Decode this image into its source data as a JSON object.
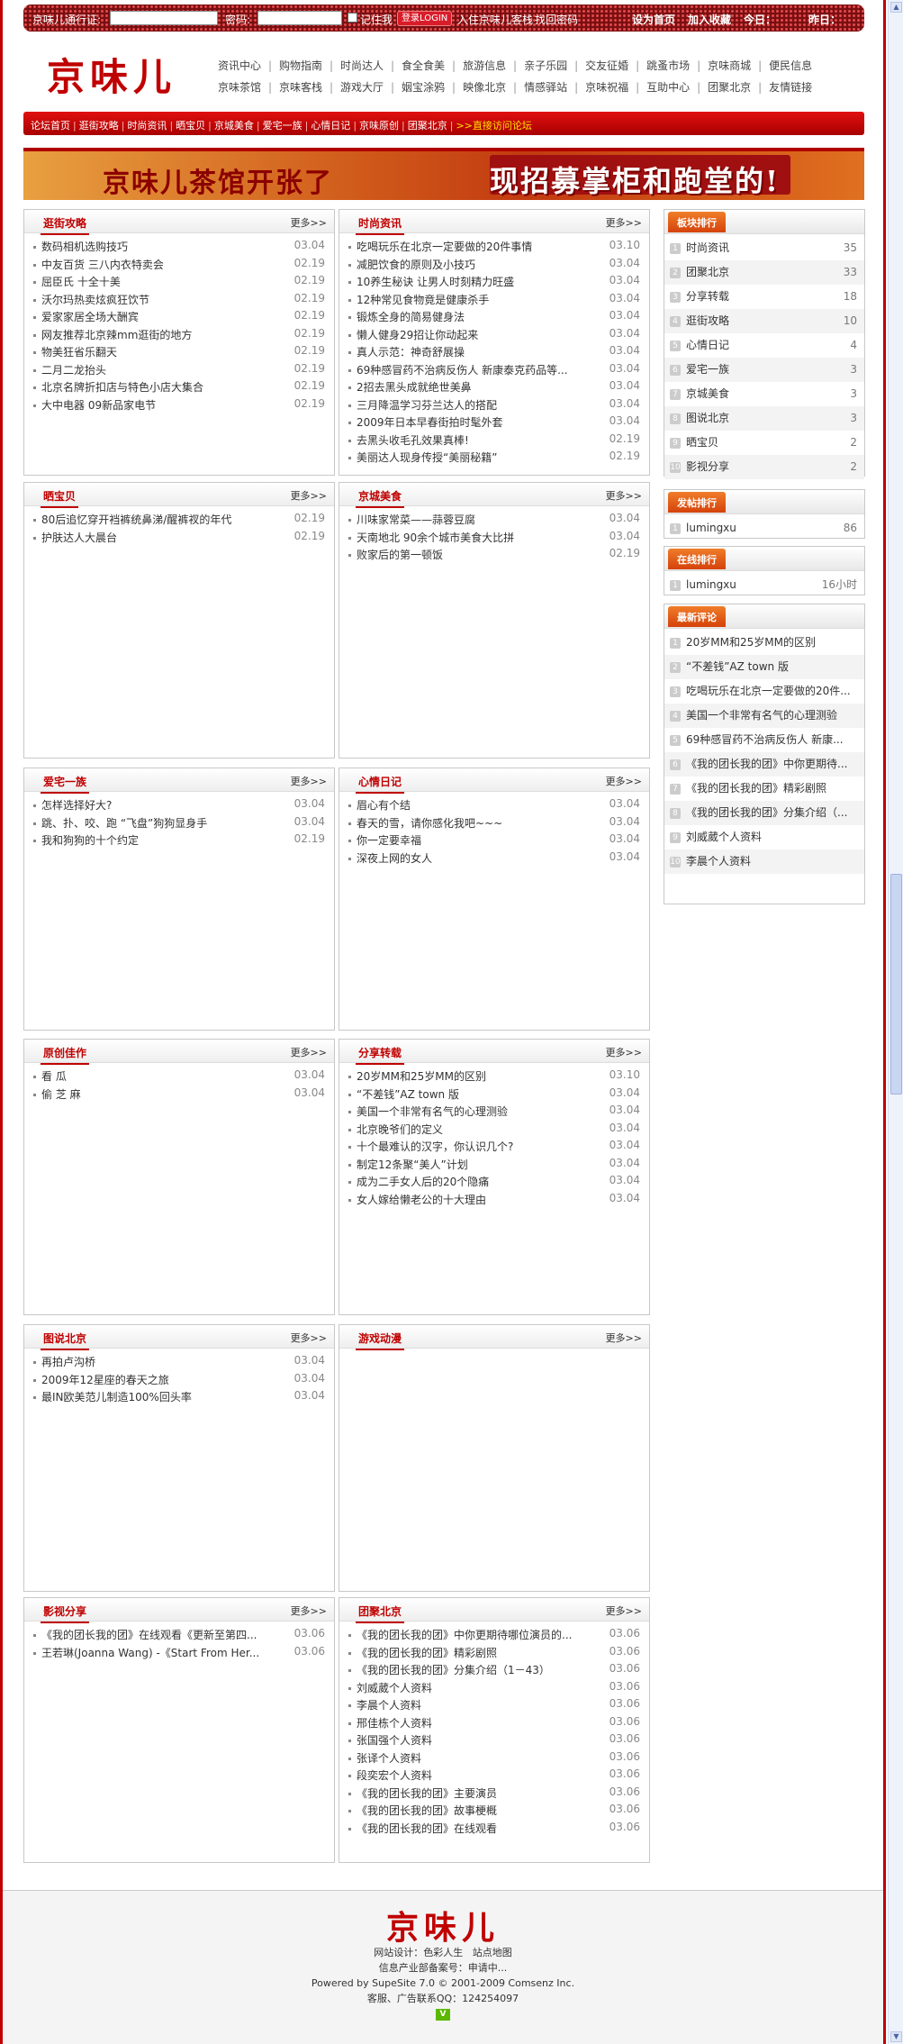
{
  "topbar": {
    "user_label": "京味儿通行证:",
    "pass_label": "密码:",
    "remember_label": "记住我",
    "login_button": "登录LOGIN",
    "register_link": "入住京味儿客栈",
    "forgot_link": "找回密码",
    "set_home": "设为首页",
    "add_fav": "加入收藏",
    "today": "今日：",
    "yesterday": "昨日："
  },
  "logo": "京味儿",
  "nav": {
    "row1": [
      "资讯中心",
      "购物指南",
      "时尚达人",
      "食全食美",
      "旅游信息",
      "亲子乐园",
      "交友征婚",
      "跳蚤市场",
      "京味商城",
      "便民信息"
    ],
    "row2": [
      "京味茶馆",
      "京味客栈",
      "游戏大厅",
      "姻宝涂鸦",
      "映像北京",
      "情感驿站",
      "京味祝福",
      "互助中心",
      "团聚北京",
      "友情链接"
    ]
  },
  "redbar": {
    "links": [
      "论坛首页",
      "逛街攻略",
      "时尚资讯",
      "晒宝贝",
      "京城美食",
      "爱宅一族",
      "心情日记",
      "京味原创",
      "团聚北京"
    ],
    "forum": ">>直接访问论坛"
  },
  "banner": {
    "left": "京味儿茶馆开张了",
    "right": "现招募掌柜和跑堂的!"
  },
  "more": "更多>>",
  "panels": [
    {
      "title": "逛街攻略",
      "items": [
        {
          "t": "数码相机选购技巧",
          "d": "03.04"
        },
        {
          "t": "中友百货 三八内衣特卖会",
          "d": "02.19"
        },
        {
          "t": "屈臣氏 十全十美",
          "d": "02.19"
        },
        {
          "t": "沃尔玛热卖炫疯狂饮节",
          "d": "02.19"
        },
        {
          "t": "爱家家居全场大酬宾",
          "d": "02.19"
        },
        {
          "t": "网友推荐北京辣mm逛街的地方",
          "d": "02.19"
        },
        {
          "t": "物美狂省乐翻天",
          "d": "02.19"
        },
        {
          "t": "二月二龙抬头",
          "d": "02.19"
        },
        {
          "t": "北京名牌折扣店与特色小店大集合",
          "d": "02.19"
        },
        {
          "t": "大中电器 09新品家电节",
          "d": "02.19"
        }
      ]
    },
    {
      "title": "时尚资讯",
      "items": [
        {
          "t": "吃喝玩乐在北京一定要做的20件事情",
          "d": "03.10"
        },
        {
          "t": "减肥饮食的原则及小技巧",
          "d": "03.04"
        },
        {
          "t": "10养生秘诀 让男人时刻精力旺盛",
          "d": "03.04"
        },
        {
          "t": "12种常见食物竟是健康杀手",
          "d": "03.04"
        },
        {
          "t": "锻炼全身的简易健身法",
          "d": "03.04"
        },
        {
          "t": "懒人健身29招让你动起来",
          "d": "03.04"
        },
        {
          "t": "真人示范：神奇舒展操",
          "d": "03.04"
        },
        {
          "t": "69种感冒药不治病反伤人 新康泰克药品等...",
          "d": "03.04"
        },
        {
          "t": "2招去黑头成就绝世美鼻",
          "d": "03.04"
        },
        {
          "t": "三月降温学习芬兰达人的搭配",
          "d": "03.04"
        },
        {
          "t": "2009年日本早春街拍时髦外套",
          "d": "03.04"
        },
        {
          "t": "去黑头收毛孔效果真棒!",
          "d": "02.19"
        },
        {
          "t": "美丽达人现身传授“美丽秘籍”",
          "d": "02.19"
        }
      ]
    },
    {
      "title": "晒宝贝",
      "items": [
        {
          "t": "80后追忆穿开裆裤统鼻涕/醒裤衩的年代",
          "d": "02.19"
        },
        {
          "t": "护肤达人大晨台",
          "d": "02.19"
        }
      ]
    },
    {
      "title": "京城美食",
      "items": [
        {
          "t": "川味家常菜——蒜蓉豆腐",
          "d": "03.04"
        },
        {
          "t": "天南地北 90余个城市美食大比拼",
          "d": "03.04"
        },
        {
          "t": "败家后的第一顿饭",
          "d": "02.19"
        }
      ]
    },
    {
      "title": "爱宅一族",
      "items": [
        {
          "t": "怎样选择好大?",
          "d": "03.04"
        },
        {
          "t": "跳、扑、咬、跑 “飞盘”狗狗显身手",
          "d": "03.04"
        },
        {
          "t": "我和狗狗的十个约定",
          "d": "02.19"
        }
      ]
    },
    {
      "title": "心情日记",
      "items": [
        {
          "t": "眉心有个结",
          "d": "03.04"
        },
        {
          "t": "春天的雪，请你感化我吧~~~",
          "d": "03.04"
        },
        {
          "t": "你一定要幸福",
          "d": "03.04"
        },
        {
          "t": "深夜上网的女人",
          "d": "03.04"
        }
      ]
    },
    {
      "title": "原创佳作",
      "items": [
        {
          "t": "看 瓜",
          "d": "03.04"
        },
        {
          "t": "偷 芝 麻",
          "d": "03.04"
        }
      ]
    },
    {
      "title": "分享转载",
      "items": [
        {
          "t": "20岁MM和25岁MM的区别",
          "d": "03.10"
        },
        {
          "t": "“不差钱”AZ town 版",
          "d": "03.04"
        },
        {
          "t": "美国一个非常有名气的心理测验",
          "d": "03.04"
        },
        {
          "t": "北京晚爷们的定义",
          "d": "03.04"
        },
        {
          "t": "十个最难认的汉字，你认识几个?",
          "d": "03.04"
        },
        {
          "t": "制定12条聚“美人”计划",
          "d": "03.04"
        },
        {
          "t": "成为二手女人后的20个隐痛",
          "d": "03.04"
        },
        {
          "t": "女人嫁给懒老公的十大理由",
          "d": "03.04"
        }
      ]
    },
    {
      "title": "图说北京",
      "items": [
        {
          "t": "再拍卢沟桥",
          "d": "03.04"
        },
        {
          "t": "2009年12星座的春天之旅",
          "d": "03.04"
        },
        {
          "t": "最IN欧美范儿制造100%回头率",
          "d": "03.04"
        }
      ]
    },
    {
      "title": "游戏动漫",
      "items": []
    },
    {
      "title": "影视分享",
      "items": [
        {
          "t": "《我的团长我的团》在线观看《更新至第四...",
          "d": "03.06"
        },
        {
          "t": "王若琳(Joanna Wang) -《Start From Her...",
          "d": "03.06"
        }
      ]
    },
    {
      "title": "团聚北京",
      "items": [
        {
          "t": "《我的团长我的团》中你更期待哪位演员的...",
          "d": "03.06"
        },
        {
          "t": "《我的团长我的团》精彩剧照",
          "d": "03.06"
        },
        {
          "t": "《我的团长我的团》分集介绍（1－43）",
          "d": "03.06"
        },
        {
          "t": "刘威葳个人资料",
          "d": "03.06"
        },
        {
          "t": "李晨个人资料",
          "d": "03.06"
        },
        {
          "t": "邢佳栋个人资料",
          "d": "03.06"
        },
        {
          "t": "张国强个人资料",
          "d": "03.06"
        },
        {
          "t": "张译个人资料",
          "d": "03.06"
        },
        {
          "t": "段奕宏个人资料",
          "d": "03.06"
        },
        {
          "t": "《我的团长我的团》主要演员",
          "d": "03.06"
        },
        {
          "t": "《我的团长我的团》故事梗概",
          "d": "03.06"
        },
        {
          "t": "《我的团长我的团》在线观看",
          "d": "03.06"
        }
      ]
    }
  ],
  "sidebar": {
    "section_rank": {
      "title": "板块排行",
      "items": [
        {
          "n": "1",
          "t": "时尚资讯",
          "c": "35"
        },
        {
          "n": "2",
          "t": "团聚北京",
          "c": "33"
        },
        {
          "n": "3",
          "t": "分享转载",
          "c": "18"
        },
        {
          "n": "4",
          "t": "逛街攻略",
          "c": "10"
        },
        {
          "n": "5",
          "t": "心情日记",
          "c": "4"
        },
        {
          "n": "6",
          "t": "爱宅一族",
          "c": "3"
        },
        {
          "n": "7",
          "t": "京城美食",
          "c": "3"
        },
        {
          "n": "8",
          "t": "图说北京",
          "c": "3"
        },
        {
          "n": "9",
          "t": "晒宝贝",
          "c": "2"
        },
        {
          "n": "10",
          "t": "影视分享",
          "c": "2"
        }
      ]
    },
    "post_rank": {
      "title": "发帖排行",
      "items": [
        {
          "n": "1",
          "t": "lumingxu",
          "c": "86"
        }
      ]
    },
    "online_rank": {
      "title": "在线排行",
      "items": [
        {
          "n": "1",
          "t": "lumingxu",
          "c": "16小时"
        }
      ]
    },
    "hot_comments": {
      "title": "最新评论",
      "items": [
        {
          "n": "1",
          "t": "20岁MM和25岁MM的区别"
        },
        {
          "n": "2",
          "t": "“不差钱”AZ town 版"
        },
        {
          "n": "3",
          "t": "吃喝玩乐在北京一定要做的20件..."
        },
        {
          "n": "4",
          "t": "美国一个非常有名气的心理测验"
        },
        {
          "n": "5",
          "t": "69种感冒药不治病反伤人 新康..."
        },
        {
          "n": "6",
          "t": "《我的团长我的团》中你更期待..."
        },
        {
          "n": "7",
          "t": "《我的团长我的团》精彩剧照"
        },
        {
          "n": "8",
          "t": "《我的团长我的团》分集介绍（..."
        },
        {
          "n": "9",
          "t": "刘威葳个人资料"
        },
        {
          "n": "10",
          "t": "李晨个人资料"
        }
      ]
    }
  },
  "footer": {
    "logo": "京味儿",
    "design": "网站设计：色彩人生",
    "sitemap": "站点地图",
    "icp": "信息产业部备案号：申请中...",
    "powered": "Powered by SupeSite 7.0 © 2001-2009 Comsenz Inc.",
    "contact": "客服、广告联系QQ：124254097",
    "badge": "V"
  },
  "colors": {
    "brand": "#c00000",
    "accent": "#e0561a"
  }
}
